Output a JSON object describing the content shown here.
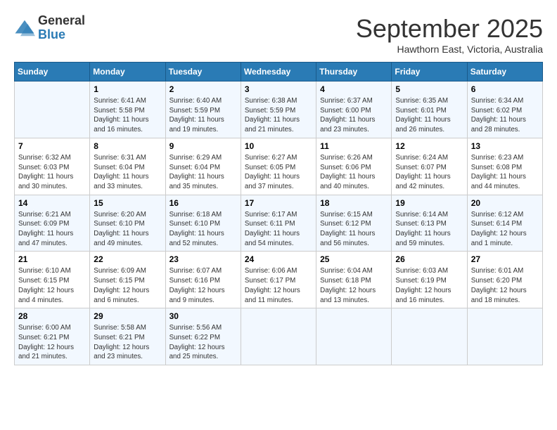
{
  "header": {
    "logo_general": "General",
    "logo_blue": "Blue",
    "month_title": "September 2025",
    "location": "Hawthorn East, Victoria, Australia"
  },
  "days_of_week": [
    "Sunday",
    "Monday",
    "Tuesday",
    "Wednesday",
    "Thursday",
    "Friday",
    "Saturday"
  ],
  "weeks": [
    [
      {
        "day": "",
        "info": ""
      },
      {
        "day": "1",
        "info": "Sunrise: 6:41 AM\nSunset: 5:58 PM\nDaylight: 11 hours\nand 16 minutes."
      },
      {
        "day": "2",
        "info": "Sunrise: 6:40 AM\nSunset: 5:59 PM\nDaylight: 11 hours\nand 19 minutes."
      },
      {
        "day": "3",
        "info": "Sunrise: 6:38 AM\nSunset: 5:59 PM\nDaylight: 11 hours\nand 21 minutes."
      },
      {
        "day": "4",
        "info": "Sunrise: 6:37 AM\nSunset: 6:00 PM\nDaylight: 11 hours\nand 23 minutes."
      },
      {
        "day": "5",
        "info": "Sunrise: 6:35 AM\nSunset: 6:01 PM\nDaylight: 11 hours\nand 26 minutes."
      },
      {
        "day": "6",
        "info": "Sunrise: 6:34 AM\nSunset: 6:02 PM\nDaylight: 11 hours\nand 28 minutes."
      }
    ],
    [
      {
        "day": "7",
        "info": "Sunrise: 6:32 AM\nSunset: 6:03 PM\nDaylight: 11 hours\nand 30 minutes."
      },
      {
        "day": "8",
        "info": "Sunrise: 6:31 AM\nSunset: 6:04 PM\nDaylight: 11 hours\nand 33 minutes."
      },
      {
        "day": "9",
        "info": "Sunrise: 6:29 AM\nSunset: 6:04 PM\nDaylight: 11 hours\nand 35 minutes."
      },
      {
        "day": "10",
        "info": "Sunrise: 6:27 AM\nSunset: 6:05 PM\nDaylight: 11 hours\nand 37 minutes."
      },
      {
        "day": "11",
        "info": "Sunrise: 6:26 AM\nSunset: 6:06 PM\nDaylight: 11 hours\nand 40 minutes."
      },
      {
        "day": "12",
        "info": "Sunrise: 6:24 AM\nSunset: 6:07 PM\nDaylight: 11 hours\nand 42 minutes."
      },
      {
        "day": "13",
        "info": "Sunrise: 6:23 AM\nSunset: 6:08 PM\nDaylight: 11 hours\nand 44 minutes."
      }
    ],
    [
      {
        "day": "14",
        "info": "Sunrise: 6:21 AM\nSunset: 6:09 PM\nDaylight: 11 hours\nand 47 minutes."
      },
      {
        "day": "15",
        "info": "Sunrise: 6:20 AM\nSunset: 6:10 PM\nDaylight: 11 hours\nand 49 minutes."
      },
      {
        "day": "16",
        "info": "Sunrise: 6:18 AM\nSunset: 6:10 PM\nDaylight: 11 hours\nand 52 minutes."
      },
      {
        "day": "17",
        "info": "Sunrise: 6:17 AM\nSunset: 6:11 PM\nDaylight: 11 hours\nand 54 minutes."
      },
      {
        "day": "18",
        "info": "Sunrise: 6:15 AM\nSunset: 6:12 PM\nDaylight: 11 hours\nand 56 minutes."
      },
      {
        "day": "19",
        "info": "Sunrise: 6:14 AM\nSunset: 6:13 PM\nDaylight: 11 hours\nand 59 minutes."
      },
      {
        "day": "20",
        "info": "Sunrise: 6:12 AM\nSunset: 6:14 PM\nDaylight: 12 hours\nand 1 minute."
      }
    ],
    [
      {
        "day": "21",
        "info": "Sunrise: 6:10 AM\nSunset: 6:15 PM\nDaylight: 12 hours\nand 4 minutes."
      },
      {
        "day": "22",
        "info": "Sunrise: 6:09 AM\nSunset: 6:15 PM\nDaylight: 12 hours\nand 6 minutes."
      },
      {
        "day": "23",
        "info": "Sunrise: 6:07 AM\nSunset: 6:16 PM\nDaylight: 12 hours\nand 9 minutes."
      },
      {
        "day": "24",
        "info": "Sunrise: 6:06 AM\nSunset: 6:17 PM\nDaylight: 12 hours\nand 11 minutes."
      },
      {
        "day": "25",
        "info": "Sunrise: 6:04 AM\nSunset: 6:18 PM\nDaylight: 12 hours\nand 13 minutes."
      },
      {
        "day": "26",
        "info": "Sunrise: 6:03 AM\nSunset: 6:19 PM\nDaylight: 12 hours\nand 16 minutes."
      },
      {
        "day": "27",
        "info": "Sunrise: 6:01 AM\nSunset: 6:20 PM\nDaylight: 12 hours\nand 18 minutes."
      }
    ],
    [
      {
        "day": "28",
        "info": "Sunrise: 6:00 AM\nSunset: 6:21 PM\nDaylight: 12 hours\nand 21 minutes."
      },
      {
        "day": "29",
        "info": "Sunrise: 5:58 AM\nSunset: 6:21 PM\nDaylight: 12 hours\nand 23 minutes."
      },
      {
        "day": "30",
        "info": "Sunrise: 5:56 AM\nSunset: 6:22 PM\nDaylight: 12 hours\nand 25 minutes."
      },
      {
        "day": "",
        "info": ""
      },
      {
        "day": "",
        "info": ""
      },
      {
        "day": "",
        "info": ""
      },
      {
        "day": "",
        "info": ""
      }
    ]
  ]
}
